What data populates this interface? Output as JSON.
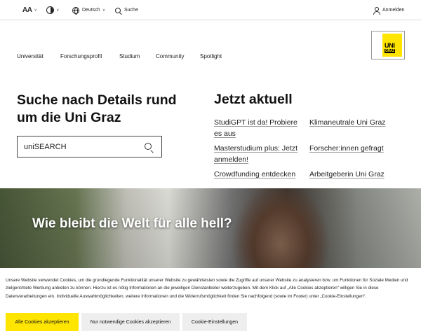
{
  "topbar": {
    "font_size_label": "AA",
    "language": "Deutsch",
    "search_label": "Suche",
    "login_label": "Anmelden"
  },
  "nav": {
    "items": [
      "Universität",
      "Forschungsprofil",
      "Studium",
      "Community",
      "Spotlight"
    ]
  },
  "logo": {
    "line1": "UNI",
    "line2": "GRAZ"
  },
  "search": {
    "title": "Suche nach Details rund um die Uni Graz",
    "placeholder": "uniSEARCH"
  },
  "news": {
    "title": "Jetzt aktuell",
    "links": [
      "StudiGPT ist da! Probiere es aus",
      "Klimaneutrale Uni Graz",
      "Masterstudium plus: Jetzt anmelden!",
      "Forscher:innen gefragt",
      "Crowdfunding entdecken",
      "Arbeitgeberin Uni Graz"
    ]
  },
  "hero": {
    "title": "Wie bleibt die Welt für alle hell?"
  },
  "cookie": {
    "text": "Unsere Website verwendet Cookies, um die grundlegende Funktionalität unserer Website zu gewährleisten sowie die Zugriffe auf unserer Website zu analysieren bzw. um Funktionen für Soziale Medien und zielgerichtete Werbung anbieten zu können. Hierzu ist es nötig Informationen an die jeweiligen Dienstanbieter weiterzugeben. Mit dem Klick auf „Alle Cookies akzeptieren“ willigen Sie in diese Datenverarbeitungen ein. Individuelle Auswahlmöglichkeiten, weitere Informationen und die Widerrufsmöglichkeit finden Sie nachfolgend (sowie im Footer) unter „Cookie-Einstellungen“.",
    "accept_all": "Alle Cookies akzeptieren",
    "necessary_only": "Nur notwendige Cookies akzeptieren",
    "settings": "Cookie-Einstellungen"
  },
  "colors": {
    "brand_yellow": "#ffe500",
    "button_grey": "#eeeeee",
    "text": "#1a1a1a"
  },
  "icons": [
    "font-size-icon",
    "contrast-icon",
    "globe-icon",
    "search-icon",
    "user-icon",
    "chevron-down-icon"
  ]
}
